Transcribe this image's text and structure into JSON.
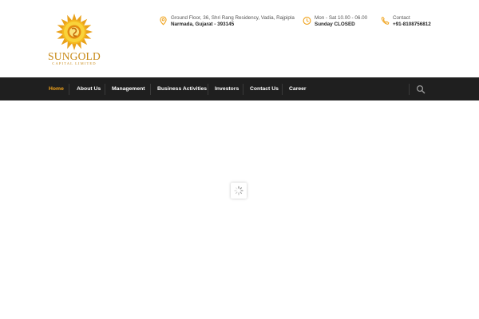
{
  "brand": {
    "name": "SUNGOLD",
    "subtitle": "CAPITAL LIMITED",
    "accent": "#f0a21a"
  },
  "contact_info": [
    {
      "icon": "location-pin-icon",
      "line1": "Ground Floor, 36, Shri Rang Residency, Vadia, Rajpipla",
      "line2": "Narmada, Gujarat - 393145"
    },
    {
      "icon": "clock-icon",
      "line1": "Mon - Sat 10.00 - 06.00",
      "line2": "Sunday CLOSED"
    },
    {
      "icon": "phone-icon",
      "line1": "Contact",
      "line2": "+91-8108756812"
    }
  ],
  "nav": {
    "items": [
      {
        "label": "Home",
        "active": true
      },
      {
        "label": "About Us",
        "active": false
      },
      {
        "label": "Management",
        "active": false
      },
      {
        "label": "Business Activities",
        "active": false
      },
      {
        "label": "Investors",
        "active": false
      },
      {
        "label": "Contact Us",
        "active": false
      },
      {
        "label": "Career",
        "active": false
      }
    ],
    "search_icon": "search-icon",
    "background": "#1f1f1f"
  },
  "loader": {
    "icon": "loading-spinner-icon"
  }
}
